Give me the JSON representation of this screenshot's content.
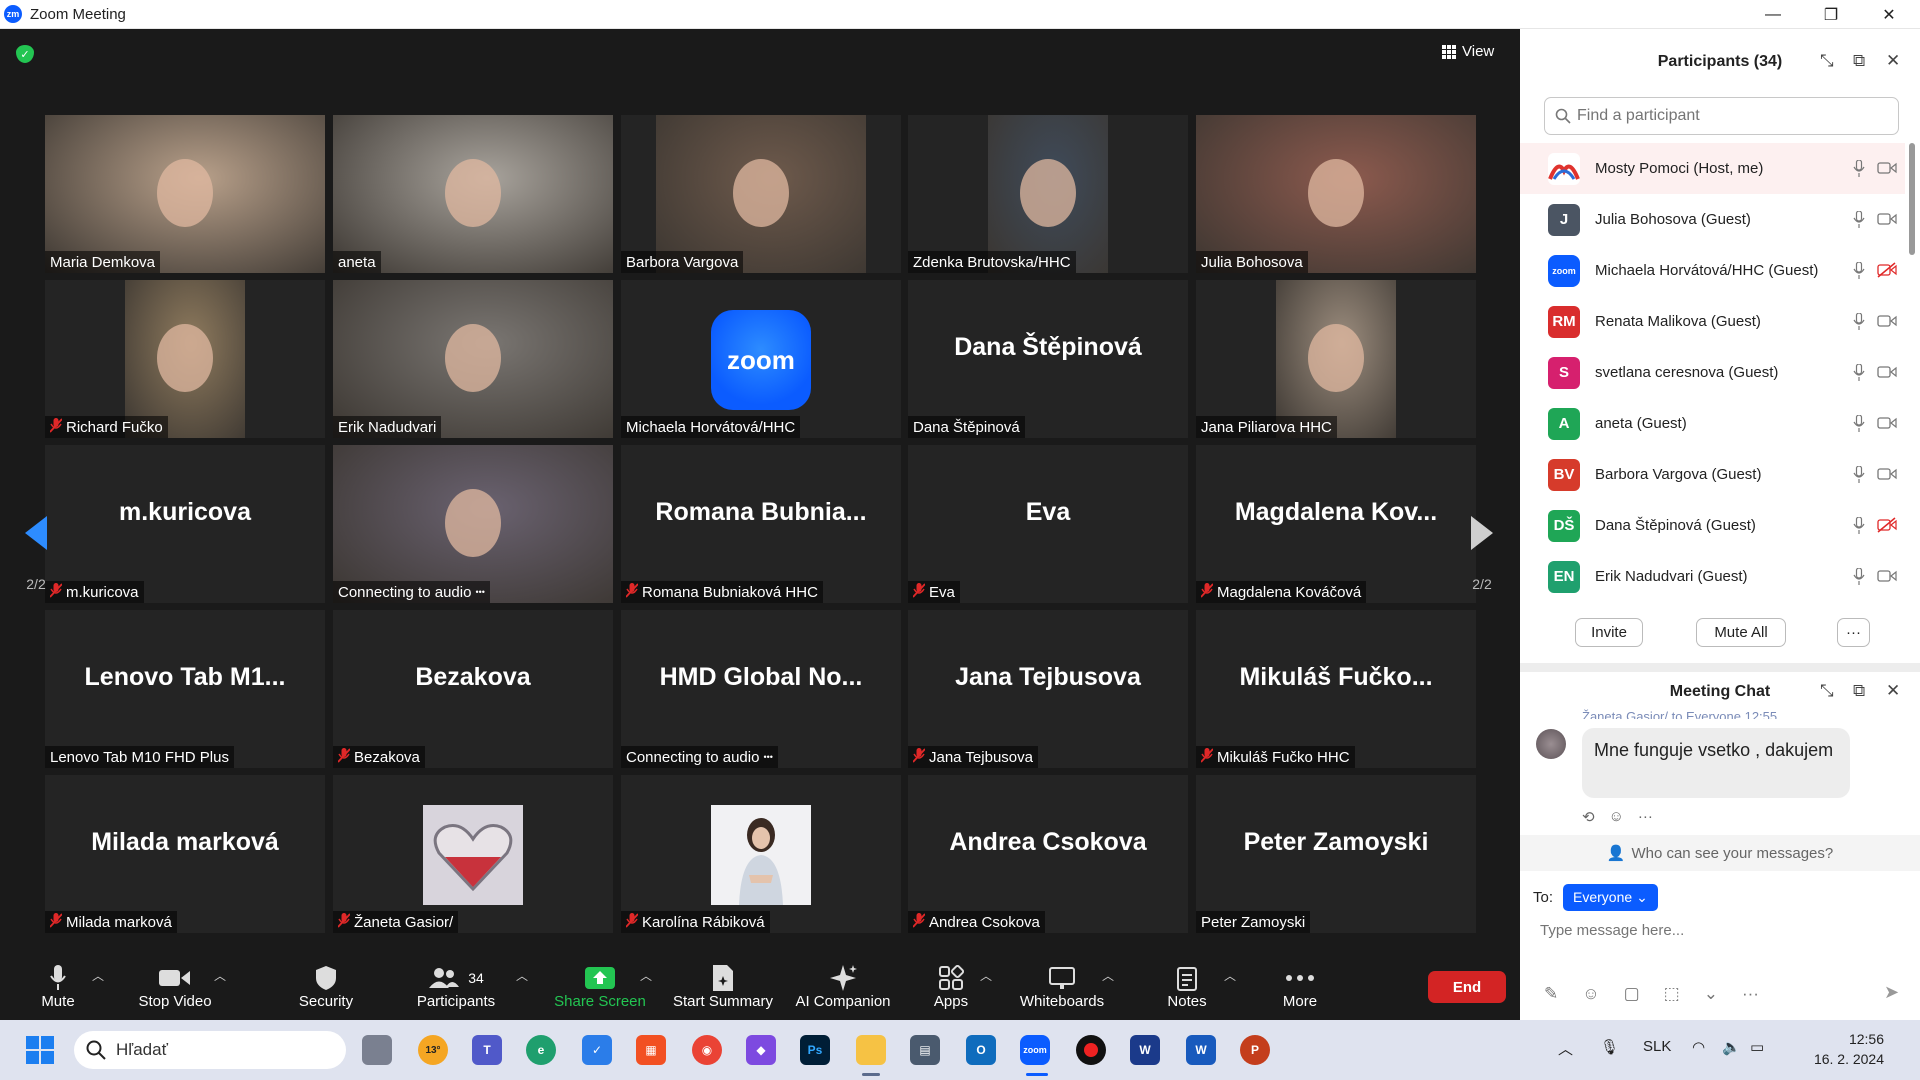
{
  "window": {
    "title": "Zoom Meeting",
    "icon_text": "zm",
    "minimize": "—",
    "restore": "❐",
    "close": "✕"
  },
  "view_button": {
    "label": "View"
  },
  "tiles": [
    {
      "label": "Maria Demkova",
      "big": "",
      "muted": false,
      "kind": "photo",
      "photo_color": "#b8a08a",
      "photo_width": 1
    },
    {
      "label": "aneta",
      "big": "",
      "muted": false,
      "kind": "photo",
      "photo_color": "#a8a39c",
      "photo_width": 1
    },
    {
      "label": "Barbora Vargova",
      "big": "",
      "muted": false,
      "kind": "photo",
      "photo_color": "#6e5a4c",
      "photo_width": 0.75
    },
    {
      "label": "Zdenka Brutovska/HHC",
      "big": "",
      "muted": false,
      "kind": "photo",
      "photo_color": "#3f4b5a",
      "photo_width": 0.43
    },
    {
      "label": "Julia Bohosova",
      "big": "",
      "muted": false,
      "kind": "photo",
      "photo_color": "#8c5a4e",
      "photo_width": 1
    },
    {
      "label": "Richard Fučko",
      "big": "",
      "muted": true,
      "kind": "photo",
      "photo_color": "#8f7b5e",
      "photo_width": 0.43
    },
    {
      "label": "Erik Nadudvari",
      "big": "",
      "muted": false,
      "kind": "photo",
      "photo_color": "#7a7672",
      "photo_width": 1
    },
    {
      "label": "Michaela Horvátová/HHC",
      "big": "",
      "muted": false,
      "kind": "zoom-logo"
    },
    {
      "label": "Dana Štěpinová",
      "big": "Dana Štěpinová",
      "muted": false,
      "kind": "name"
    },
    {
      "label": "Jana Piliarova HHC",
      "big": "",
      "muted": false,
      "kind": "photo",
      "photo_color": "#9c8d7e",
      "photo_width": 0.43
    },
    {
      "label": "m.kuricova",
      "big": "m.kuricova",
      "muted": true,
      "kind": "name"
    },
    {
      "label": "Connecting to audio",
      "big": "",
      "muted": false,
      "kind": "photo",
      "photo_color": "#6a6270",
      "photo_width": 1,
      "connecting": true
    },
    {
      "label": "Romana Bubniaková HHC",
      "big": "Romana  Bubnia...",
      "muted": true,
      "kind": "name"
    },
    {
      "label": "Eva",
      "big": "Eva",
      "muted": true,
      "kind": "name"
    },
    {
      "label": "Magdalena Kováčová",
      "big": "Magdalena  Kov...",
      "muted": true,
      "kind": "name"
    },
    {
      "label": "Lenovo Tab M10 FHD Plus",
      "big": "Lenovo  Tab  M1...",
      "muted": false,
      "kind": "name"
    },
    {
      "label": "Bezakova",
      "big": "Bezakova",
      "muted": true,
      "kind": "name"
    },
    {
      "label": "Connecting to audio",
      "big": "HMD  Global  No...",
      "muted": false,
      "kind": "name",
      "connecting": true
    },
    {
      "label": "Jana Tejbusova",
      "big": "Jana Tejbusova",
      "muted": true,
      "kind": "name"
    },
    {
      "label": "Mikuláš Fučko HHC",
      "big": "Mikuláš  Fučko...",
      "muted": true,
      "kind": "name"
    },
    {
      "label": "Milada marková",
      "big": "Milada marková",
      "muted": true,
      "kind": "name"
    },
    {
      "label": "Žaneta Gasior/",
      "big": "",
      "muted": true,
      "kind": "thumb-heart"
    },
    {
      "label": "Karolína Rábiková",
      "big": "",
      "muted": true,
      "kind": "thumb-person"
    },
    {
      "label": "Andrea Csokova",
      "big": "Andrea Csokova",
      "muted": true,
      "kind": "name"
    },
    {
      "label": "Peter Zamoyski",
      "big": "Peter Zamoyski",
      "muted": false,
      "kind": "name"
    }
  ],
  "pager": {
    "left": "2/2",
    "right": "2/2"
  },
  "toolbar": {
    "mute": "Mute",
    "stop_video": "Stop Video",
    "security": "Security",
    "participants": "Participants",
    "participants_count": "34",
    "share_screen": "Share Screen",
    "start_summary": "Start Summary",
    "ai_companion": "AI Companion",
    "apps": "Apps",
    "whiteboards": "Whiteboards",
    "notes": "Notes",
    "more": "More",
    "end": "End"
  },
  "participants_panel": {
    "title": "Participants (34)",
    "search_placeholder": "Find a participant",
    "participants": [
      {
        "name": "Mosty Pomoci (Host, me)",
        "initials": "",
        "color": "#ffffff",
        "video_off": false
      },
      {
        "name": "Julia Bohosova (Guest)",
        "initials": "J",
        "color": "#4b5563",
        "video_off": false
      },
      {
        "name": "Michaela Horvátová/HHC (Guest)",
        "initials": "zoom",
        "color": "#0b5cff",
        "video_off": true
      },
      {
        "name": "Renata Malikova (Guest)",
        "initials": "RM",
        "color": "#d92d2d",
        "video_off": false
      },
      {
        "name": "svetlana ceresnova (Guest)",
        "initials": "S",
        "color": "#d6206e",
        "video_off": false
      },
      {
        "name": "aneta (Guest)",
        "initials": "A",
        "color": "#1fa656",
        "video_off": false
      },
      {
        "name": "Barbora Vargova (Guest)",
        "initials": "BV",
        "color": "#d63b2b",
        "video_off": false
      },
      {
        "name": "Dana Štěpinová (Guest)",
        "initials": "DŠ",
        "color": "#1fa656",
        "video_off": true
      },
      {
        "name": "Erik Nadudvari (Guest)",
        "initials": "EN",
        "color": "#1fa06e",
        "video_off": false
      }
    ],
    "invite": "Invite",
    "mute_all": "Mute All",
    "more": "···"
  },
  "chat": {
    "title": "Meeting Chat",
    "meta": "Žaneta Gasior/ to Everyone 12:55",
    "message": "Mne funguje vsetko , dakujem",
    "who_can_see": "Who can see your messages?",
    "to_label": "To:",
    "to_value": "Everyone",
    "input_placeholder": "Type message here..."
  },
  "taskbar": {
    "search_placeholder": "Hľadať",
    "weather": "13°",
    "language": "SLK",
    "time": "12:56",
    "date": "16. 2. 2024"
  }
}
